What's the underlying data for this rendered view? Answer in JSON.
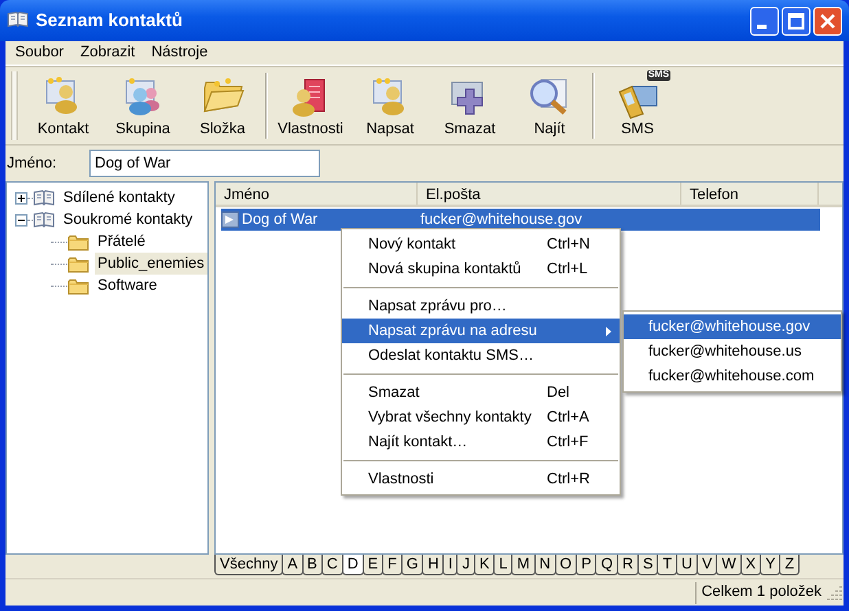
{
  "window": {
    "title": "Seznam kontaktů"
  },
  "menu": [
    {
      "label": "Soubor"
    },
    {
      "label": "Zobrazit"
    },
    {
      "label": "Nástroje"
    }
  ],
  "toolbar": [
    [
      {
        "kind": "contact",
        "label": "Kontakt"
      },
      {
        "kind": "group",
        "label": "Skupina"
      },
      {
        "kind": "folder",
        "label": "Složka"
      }
    ],
    [
      {
        "kind": "properties",
        "label": "Vlastnosti"
      },
      {
        "kind": "write",
        "label": "Napsat"
      },
      {
        "kind": "delete",
        "label": "Smazat"
      },
      {
        "kind": "find",
        "label": "Najít"
      }
    ],
    [
      {
        "kind": "sms",
        "label": "SMS",
        "badge": "SMS"
      }
    ]
  ],
  "name_field": {
    "label": "Jméno:",
    "value": "Dog of War"
  },
  "tree": [
    {
      "kind": "book",
      "label": "Sdílené kontakty",
      "expanded": false,
      "selected": false
    },
    {
      "kind": "book",
      "label": "Soukromé kontakty",
      "expanded": true,
      "selected": false,
      "children": [
        {
          "kind": "folder",
          "label": "Přátelé",
          "selected": false
        },
        {
          "kind": "folder",
          "label": "Public_enemies",
          "selected": true
        },
        {
          "kind": "folder",
          "label": "Software",
          "selected": false
        }
      ]
    }
  ],
  "table": {
    "columns": [
      "Jméno",
      "El.pošta",
      "Telefon"
    ],
    "rows": [
      {
        "cells": [
          "Dog of War",
          "fucker@whitehouse.gov"
        ],
        "selected": true
      }
    ]
  },
  "context_menu": [
    [
      {
        "label": "Nový kontakt",
        "shortcut": "Ctrl+N",
        "selected": false
      },
      {
        "label": "Nová skupina kontaktů",
        "shortcut": "Ctrl+L",
        "selected": false
      }
    ],
    [
      {
        "label": "Napsat zprávu pro…",
        "selected": false
      },
      {
        "label": "Napsat zprávu na adresu",
        "selected": true,
        "submenu": true
      },
      {
        "label": "Odeslat kontaktu SMS…",
        "selected": false
      }
    ],
    [
      {
        "label": "Smazat",
        "shortcut": "Del",
        "selected": false
      },
      {
        "label": "Vybrat všechny kontakty",
        "shortcut": "Ctrl+A",
        "selected": false
      },
      {
        "label": "Najít kontakt…",
        "shortcut": "Ctrl+F",
        "selected": false
      }
    ],
    [
      {
        "label": "Vlastnosti",
        "shortcut": "Ctrl+R",
        "selected": false
      }
    ]
  ],
  "submenu": [
    {
      "label": "fucker@whitehouse.gov",
      "selected": true
    },
    {
      "label": "fucker@whitehouse.us",
      "selected": false
    },
    {
      "label": "fucker@whitehouse.com",
      "selected": false
    }
  ],
  "letter_tabs": [
    {
      "label": "Všechny",
      "selected": false
    },
    {
      "label": "A",
      "selected": false
    },
    {
      "label": "B",
      "selected": false
    },
    {
      "label": "C",
      "selected": false
    },
    {
      "label": "D",
      "selected": true
    },
    {
      "label": "E",
      "selected": false
    },
    {
      "label": "F",
      "selected": false
    },
    {
      "label": "G",
      "selected": false
    },
    {
      "label": "H",
      "selected": false
    },
    {
      "label": "I",
      "selected": false
    },
    {
      "label": "J",
      "selected": false
    },
    {
      "label": "K",
      "selected": false
    },
    {
      "label": "L",
      "selected": false
    },
    {
      "label": "M",
      "selected": false
    },
    {
      "label": "N",
      "selected": false
    },
    {
      "label": "O",
      "selected": false
    },
    {
      "label": "P",
      "selected": false
    },
    {
      "label": "Q",
      "selected": false
    },
    {
      "label": "R",
      "selected": false
    },
    {
      "label": "S",
      "selected": false
    },
    {
      "label": "T",
      "selected": false
    },
    {
      "label": "U",
      "selected": false
    },
    {
      "label": "V",
      "selected": false
    },
    {
      "label": "W",
      "selected": false
    },
    {
      "label": "X",
      "selected": false
    },
    {
      "label": "Y",
      "selected": false
    },
    {
      "label": "Z",
      "selected": false
    }
  ],
  "status_bar": {
    "text": "Celkem 1 položek"
  }
}
